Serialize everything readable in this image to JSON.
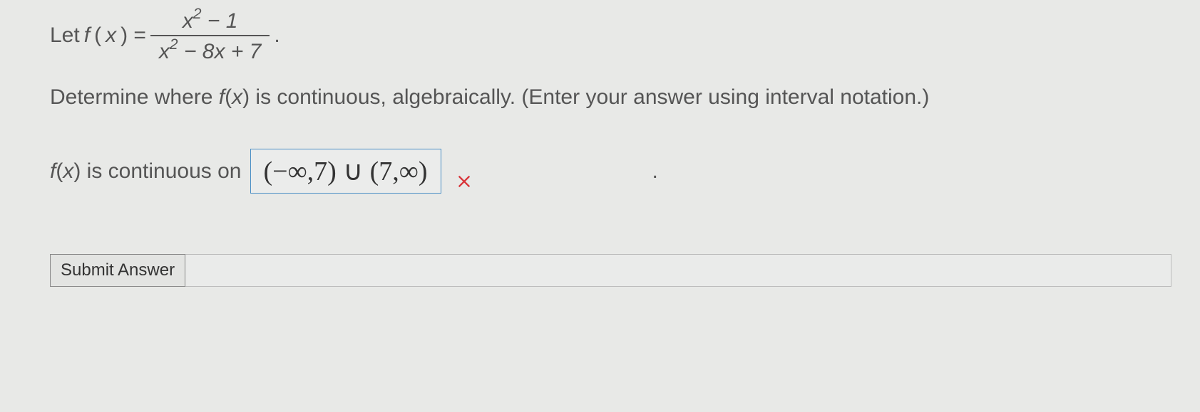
{
  "problem": {
    "let_prefix": "Let ",
    "function_lhs": "f(x) = ",
    "numerator": "x² − 1",
    "denominator": "x² − 8x + 7",
    "period": ".",
    "instruction": "Determine where f(x) is continuous, algebraically. (Enter your answer using interval notation.)",
    "answer_label_prefix": "f(x)",
    "answer_label_rest": " is continuous on ",
    "student_answer": "(−∞,7) ∪ (7,∞)",
    "feedback_icon": "incorrect",
    "extra_dot": "."
  },
  "controls": {
    "submit_label": "Submit Answer"
  }
}
